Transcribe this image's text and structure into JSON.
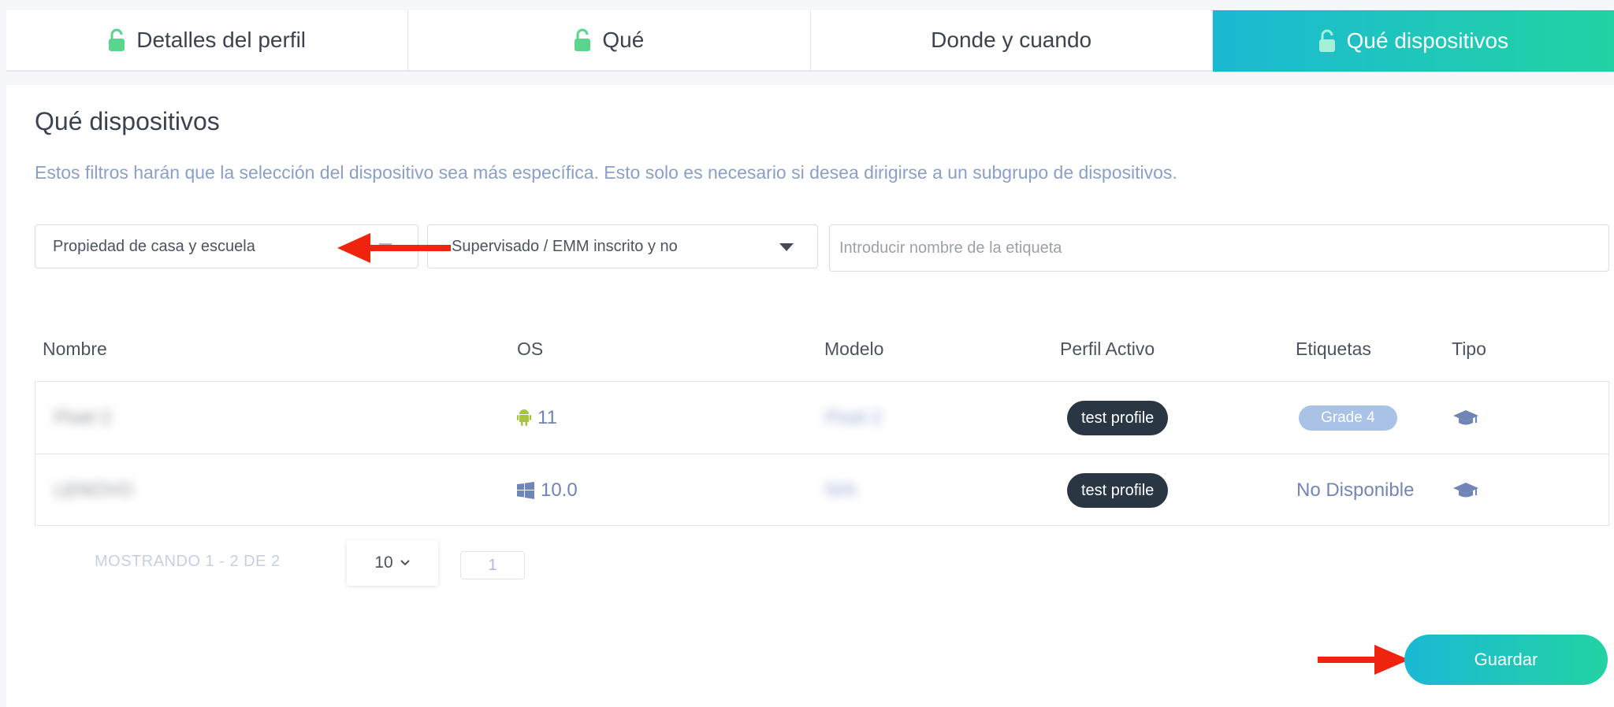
{
  "tabs": [
    {
      "label": "Detalles del perfil",
      "icon": "lock-open-icon",
      "active": false
    },
    {
      "label": "Qué",
      "icon": "lock-open-icon",
      "active": false
    },
    {
      "label": "Donde y cuando",
      "icon": "",
      "active": false
    },
    {
      "label": "Qué dispositivos",
      "icon": "lock-open-icon",
      "active": true
    }
  ],
  "section": {
    "title": "Qué dispositivos",
    "description": "Estos filtros harán que la selección del dispositivo sea más específica. Esto solo es necesario si desea dirigirse a un subgrupo de dispositivos."
  },
  "filters": {
    "ownership_value": "Propiedad de casa y escuela",
    "supervision_value": "Supervisado / EMM inscrito y no",
    "tag_placeholder": "Introducir nombre de la etiqueta"
  },
  "table": {
    "headers": [
      "Nombre",
      "OS",
      "Modelo",
      "Perfil Activo",
      "Etiquetas",
      "Tipo"
    ],
    "rows": [
      {
        "name": "Pixel 2",
        "os_icon": "android-icon",
        "os_version": "11",
        "model": "Pixel 2",
        "profile": "test profile",
        "tag": "Grade 4",
        "type_icon": "graduation-cap-icon"
      },
      {
        "name": "LENOVO",
        "os_icon": "windows-icon",
        "os_version": "10.0",
        "model": "N/A",
        "profile": "test profile",
        "tag": "No Disponible",
        "type_icon": "graduation-cap-icon"
      }
    ]
  },
  "pagination": {
    "showing": "MOSTRANDO 1 - 2 DE 2",
    "per_page": "10",
    "current_page": "1"
  },
  "save_label": "Guardar",
  "colors": {
    "accent_start": "#1bb9d4",
    "accent_end": "#22d3a3",
    "lock_green": "#58d68d",
    "arrow_red": "#f0230f",
    "android_green": "#a4c639",
    "link_blue": "#6f85b8"
  }
}
